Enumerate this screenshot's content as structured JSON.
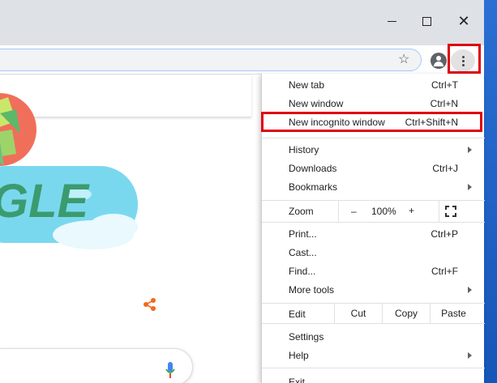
{
  "window": {
    "minimize_label": "—",
    "maximize_label": "☐",
    "close_label": "✕"
  },
  "toolbar": {
    "bookmark_icon": "star-icon",
    "profile_icon": "account-circle-icon",
    "menu_icon": "three-dot-menu-icon"
  },
  "colors": {
    "highlight": "#e0000f",
    "doodle_green": "#3b9b6e",
    "doodle_cyan": "#76dcef",
    "share": "#f06a1e",
    "mic_blue": "#4285f4",
    "mic_red": "#ea4335"
  },
  "doodle": {
    "text": "GLE"
  },
  "menu": {
    "group1": [
      {
        "label": "New tab",
        "shortcut": "Ctrl+T"
      },
      {
        "label": "New window",
        "shortcut": "Ctrl+N"
      },
      {
        "label": "New incognito window",
        "shortcut": "Ctrl+Shift+N"
      }
    ],
    "group2": [
      {
        "label": "History",
        "shortcut": ""
      },
      {
        "label": "Downloads",
        "shortcut": "Ctrl+J"
      },
      {
        "label": "Bookmarks",
        "shortcut": ""
      }
    ],
    "zoom": {
      "label": "Zoom",
      "minus": "–",
      "value": "100%",
      "plus": "+"
    },
    "group3": [
      {
        "label": "Print...",
        "shortcut": "Ctrl+P"
      },
      {
        "label": "Cast...",
        "shortcut": ""
      },
      {
        "label": "Find...",
        "shortcut": "Ctrl+F"
      },
      {
        "label": "More tools",
        "shortcut": ""
      }
    ],
    "edit": {
      "label": "Edit",
      "cut": "Cut",
      "copy": "Copy",
      "paste": "Paste"
    },
    "group4": [
      {
        "label": "Settings",
        "shortcut": ""
      },
      {
        "label": "Help",
        "shortcut": ""
      },
      {
        "label": "Exit",
        "shortcut": ""
      }
    ]
  }
}
